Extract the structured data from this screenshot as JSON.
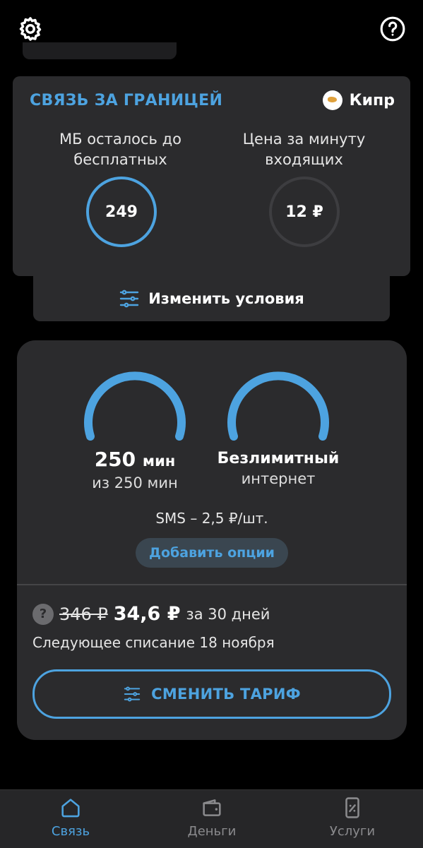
{
  "header": {
    "settings_icon": "gear-icon",
    "help_icon": "help-circle-icon"
  },
  "roaming": {
    "title": "СВЯЗЬ ЗА ГРАНИЦЕЙ",
    "country": "Кипр",
    "mb_label": "МБ осталось до бесплатных",
    "mb_value": "249",
    "price_label": "Цена за минуту входящих",
    "price_value": "12 ₽",
    "change_conditions": "Изменить условия"
  },
  "tariff": {
    "minutes_value": "250",
    "minutes_unit": "мин",
    "minutes_total": "из 250 мин",
    "internet_main": "Безлимитный",
    "internet_sub": "интернет",
    "sms": "SMS – 2,5 ₽/шт.",
    "add_options": "Добавить опции",
    "old_price": "346 ₽",
    "new_price": "34,6 ₽",
    "period": "за 30 дней",
    "next_charge": "Следующее списание 18 ноября",
    "change_tariff": "СМЕНИТЬ ТАРИФ"
  },
  "nav": {
    "items": [
      {
        "label": "Связь",
        "icon": "home-icon",
        "active": true
      },
      {
        "label": "Деньги",
        "icon": "wallet-icon",
        "active": false
      },
      {
        "label": "Услуги",
        "icon": "phone-percent-icon",
        "active": false
      }
    ]
  },
  "colors": {
    "accent": "#4da3e0",
    "card": "#2b2b2d",
    "background": "#000000",
    "inactive": "#8a8a8d"
  }
}
